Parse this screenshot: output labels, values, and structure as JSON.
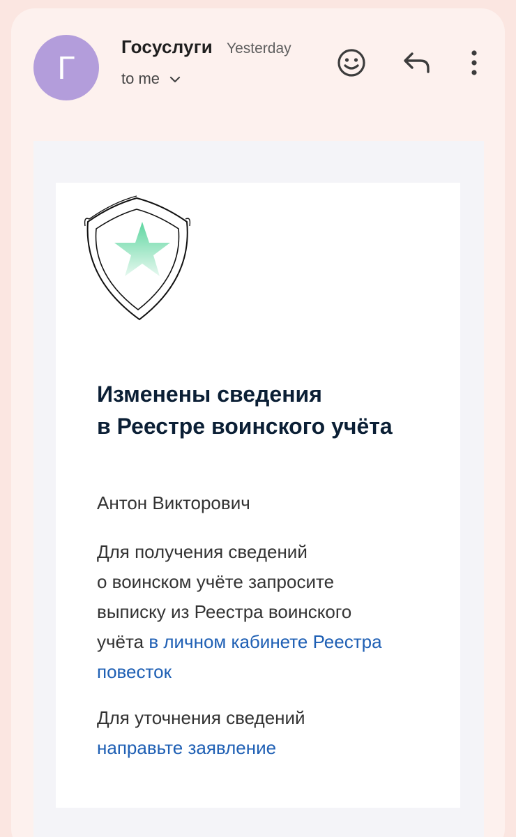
{
  "header": {
    "avatar_letter": "Г",
    "sender": "Госуслуги",
    "time": "Yesterday",
    "recipient": "to me",
    "icons": [
      "emoji-icon",
      "reply-icon",
      "more-vert-icon"
    ]
  },
  "email": {
    "headline_line1": "Изменены сведения",
    "headline_line2": "в Реестре воинского учёта",
    "greeting": "Антон Викторович",
    "para1": {
      "line1": "Для получения сведений",
      "line2": "о воинском учёте запросите",
      "line3": "выписку из Реестра воинского",
      "line4_prefix": "учёта ",
      "link_part1": "в личном кабинете Реестра",
      "link_part2": "повесток"
    },
    "para2": {
      "line1": "Для уточнения сведений",
      "link": "направьте заявление"
    }
  },
  "colors": {
    "background": "#fbe6e1",
    "avatar": "#b39ddb",
    "link": "#1e5fb4",
    "headline": "#0b1f35",
    "star": "#6fdcaa"
  }
}
